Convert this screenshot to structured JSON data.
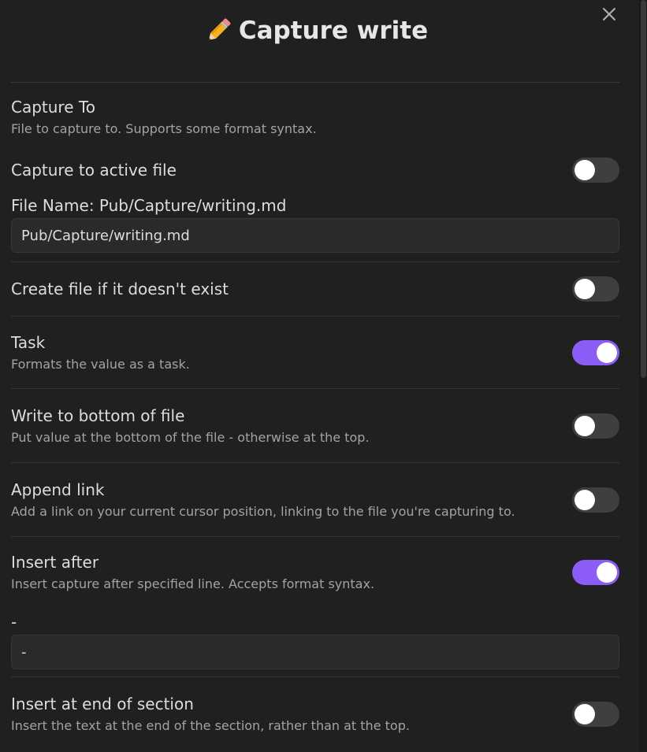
{
  "modal": {
    "title": "Capture write",
    "title_icon": "pencil-icon",
    "close_icon": "close-icon"
  },
  "capture_to": {
    "name": "Capture To",
    "desc": "File to capture to. Supports some format syntax."
  },
  "capture_active": {
    "name": "Capture to active file",
    "enabled": false
  },
  "file_name": {
    "label": "File Name: Pub/Capture/writing.md",
    "value": "Pub/Capture/writing.md"
  },
  "create_file": {
    "name": "Create file if it doesn't exist",
    "enabled": false
  },
  "task": {
    "name": "Task",
    "desc": "Formats the value as a task.",
    "enabled": true
  },
  "write_bottom": {
    "name": "Write to bottom of file",
    "desc": "Put value at the bottom of the file - otherwise at the top.",
    "enabled": false
  },
  "append_link": {
    "name": "Append link",
    "desc": "Add a link on your current cursor position, linking to the file you're capturing to.",
    "enabled": false
  },
  "insert_after": {
    "name": "Insert after",
    "desc": "Insert capture after specified line. Accepts format syntax.",
    "enabled": true,
    "field_label": "-",
    "field_value": "-"
  },
  "insert_end": {
    "name": "Insert at end of section",
    "desc": "Insert the text at the end of the section, rather than at the top.",
    "enabled": false
  },
  "colors": {
    "background": "#202020",
    "accent": "#8b5cf6",
    "toggle_off": "#3f3f3f"
  }
}
